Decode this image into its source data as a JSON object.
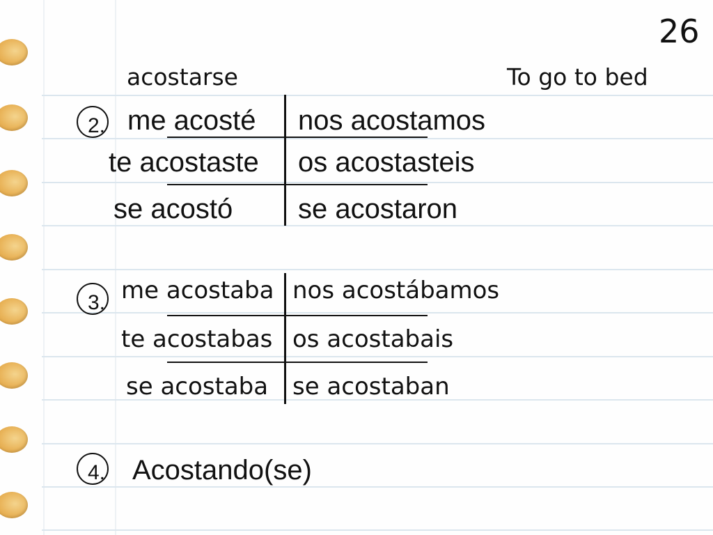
{
  "slide_number": "26",
  "header": {
    "verb": "acostarse",
    "translation": "To go to bed"
  },
  "section2": {
    "number": "2.",
    "rows": [
      [
        "me acosté",
        "nos acostamos"
      ],
      [
        "te acostaste",
        "os acostasteis"
      ],
      [
        "se acostó",
        "se acostaron"
      ]
    ]
  },
  "section3": {
    "number": "3.",
    "rows": [
      [
        "me acostaba",
        "nos acostábamos"
      ],
      [
        "te acostabas",
        "os acostabais"
      ],
      [
        "se acostaba",
        "se acostaban"
      ]
    ]
  },
  "section4": {
    "number": "4.",
    "text": "Acostando(se)"
  },
  "colors": {
    "rule": "#dbe6ee",
    "ring": "#e9b45a",
    "ink": "#111111"
  }
}
